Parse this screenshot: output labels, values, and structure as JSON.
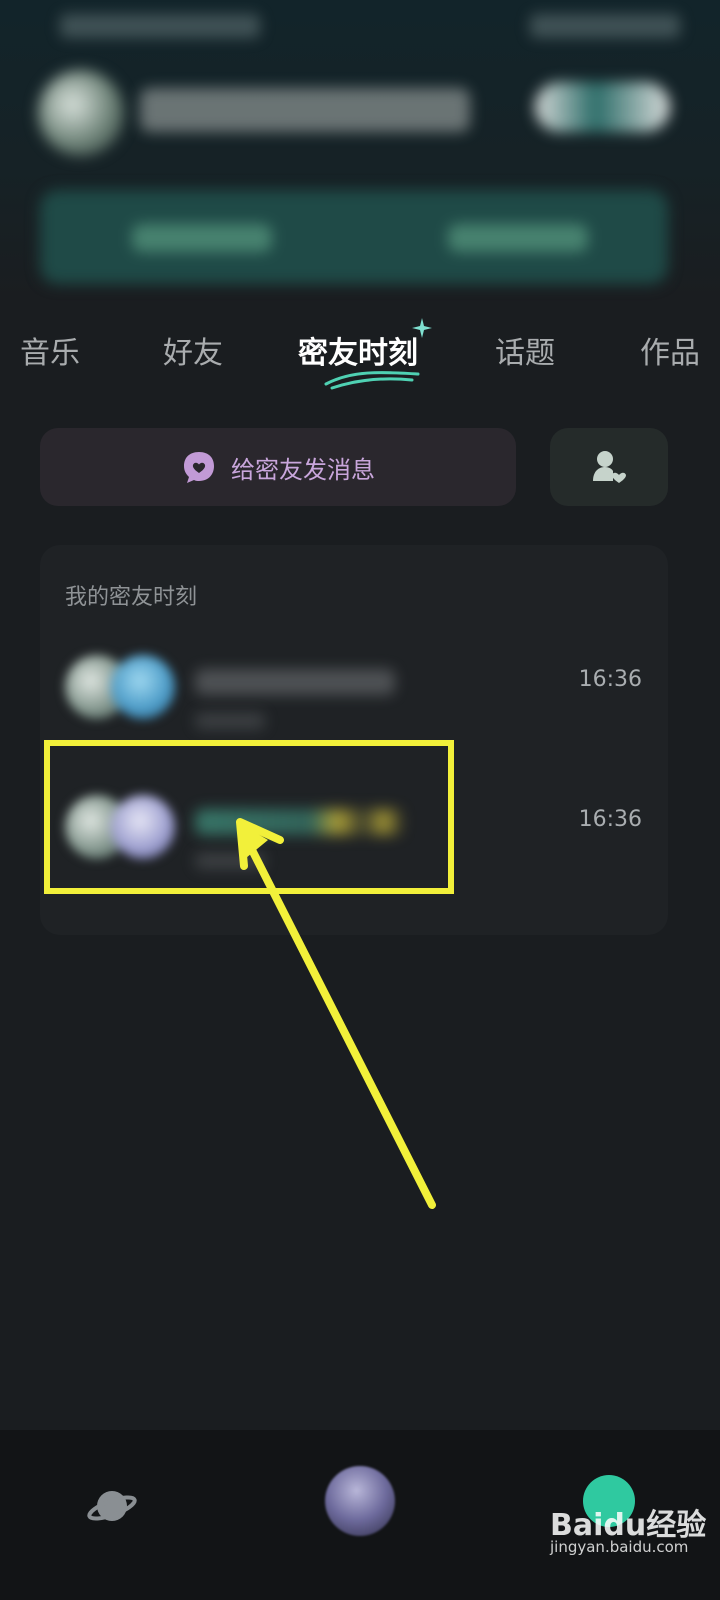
{
  "tabs": [
    {
      "label": "音乐",
      "active": false
    },
    {
      "label": "好友",
      "active": false
    },
    {
      "label": "密友时刻",
      "active": true
    },
    {
      "label": "话题",
      "active": false
    },
    {
      "label": "作品",
      "active": false
    }
  ],
  "actions": {
    "send_message_label": "给密友发消息",
    "message_icon": "heart-chat-icon",
    "friend_icon": "friend-heart-icon"
  },
  "moments": {
    "title": "我的密友时刻",
    "rows": [
      {
        "time": "16:36"
      },
      {
        "time": "16:36"
      }
    ]
  },
  "colors": {
    "accent_purple": "#c9a6dc",
    "highlight_yellow": "#f2f03a",
    "nav_teal": "#2fc9a0"
  },
  "watermark": {
    "brand": "Baidu经验",
    "url": "jingyan.baidu.com"
  }
}
